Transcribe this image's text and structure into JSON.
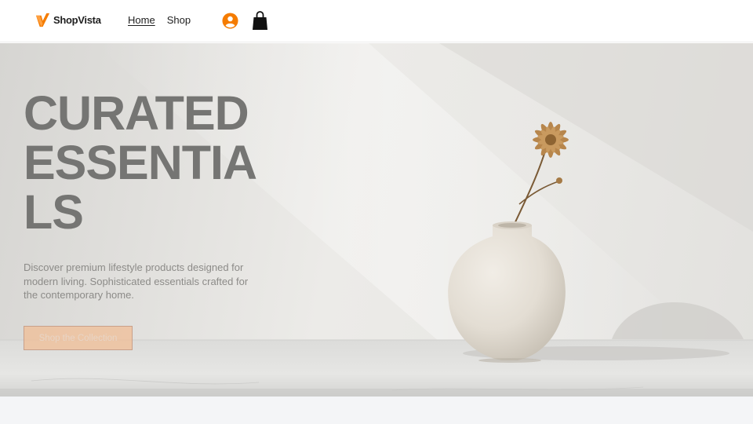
{
  "header": {
    "logo": {
      "text": "ShopVista",
      "icon": "v-logo-icon",
      "accent": "#f57c00"
    },
    "nav": [
      {
        "label": "Home",
        "active": true
      },
      {
        "label": "Shop",
        "active": false
      }
    ],
    "account_icon": "user-circle-icon",
    "cart_icon": "shopping-bag-icon"
  },
  "hero": {
    "title": "CURATED ESSENTIALS",
    "subtitle": "Discover premium lifestyle products designed for modern living. Sophisticated essentials crafted for the contemporary home.",
    "cta_label": "Shop the Collection",
    "image_icon": "vase-with-dried-flower-image"
  },
  "colors": {
    "accent": "#f57c00",
    "title_text": "#757573",
    "cta_bg": "#f0be96",
    "page_bg": "#f4f5f7"
  }
}
